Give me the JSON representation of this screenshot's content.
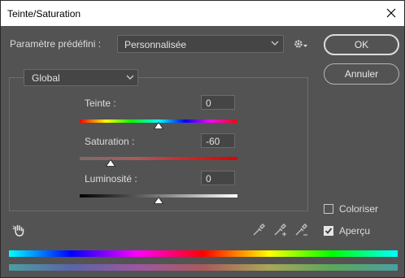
{
  "window": {
    "title": "Teinte/Saturation"
  },
  "preset": {
    "label": "Paramètre prédéfini :",
    "value": "Personnalisée"
  },
  "buttons": {
    "ok": "OK",
    "cancel": "Annuler"
  },
  "channel": {
    "value": "Global"
  },
  "sliders": {
    "hue": {
      "label": "Teinte :",
      "value": "0"
    },
    "saturation": {
      "label": "Saturation :",
      "value": "-60"
    },
    "lightness": {
      "label": "Luminosité :",
      "value": "0"
    }
  },
  "options": {
    "colorize": {
      "label": "Coloriser",
      "checked": false
    },
    "preview": {
      "label": "Aperçu",
      "checked": true
    }
  },
  "icons": {
    "close": "close-icon",
    "preset_menu": "gear-icon",
    "hand": "hand-tool-icon",
    "eyedropper": "eyedropper-icon",
    "eyedropper_add": "eyedropper-plus-icon",
    "eyedropper_sub": "eyedropper-minus-icon"
  },
  "colors": {
    "panel_bg": "#535353",
    "field_bg": "#454545",
    "titlebar_bg": "#ffffff"
  }
}
